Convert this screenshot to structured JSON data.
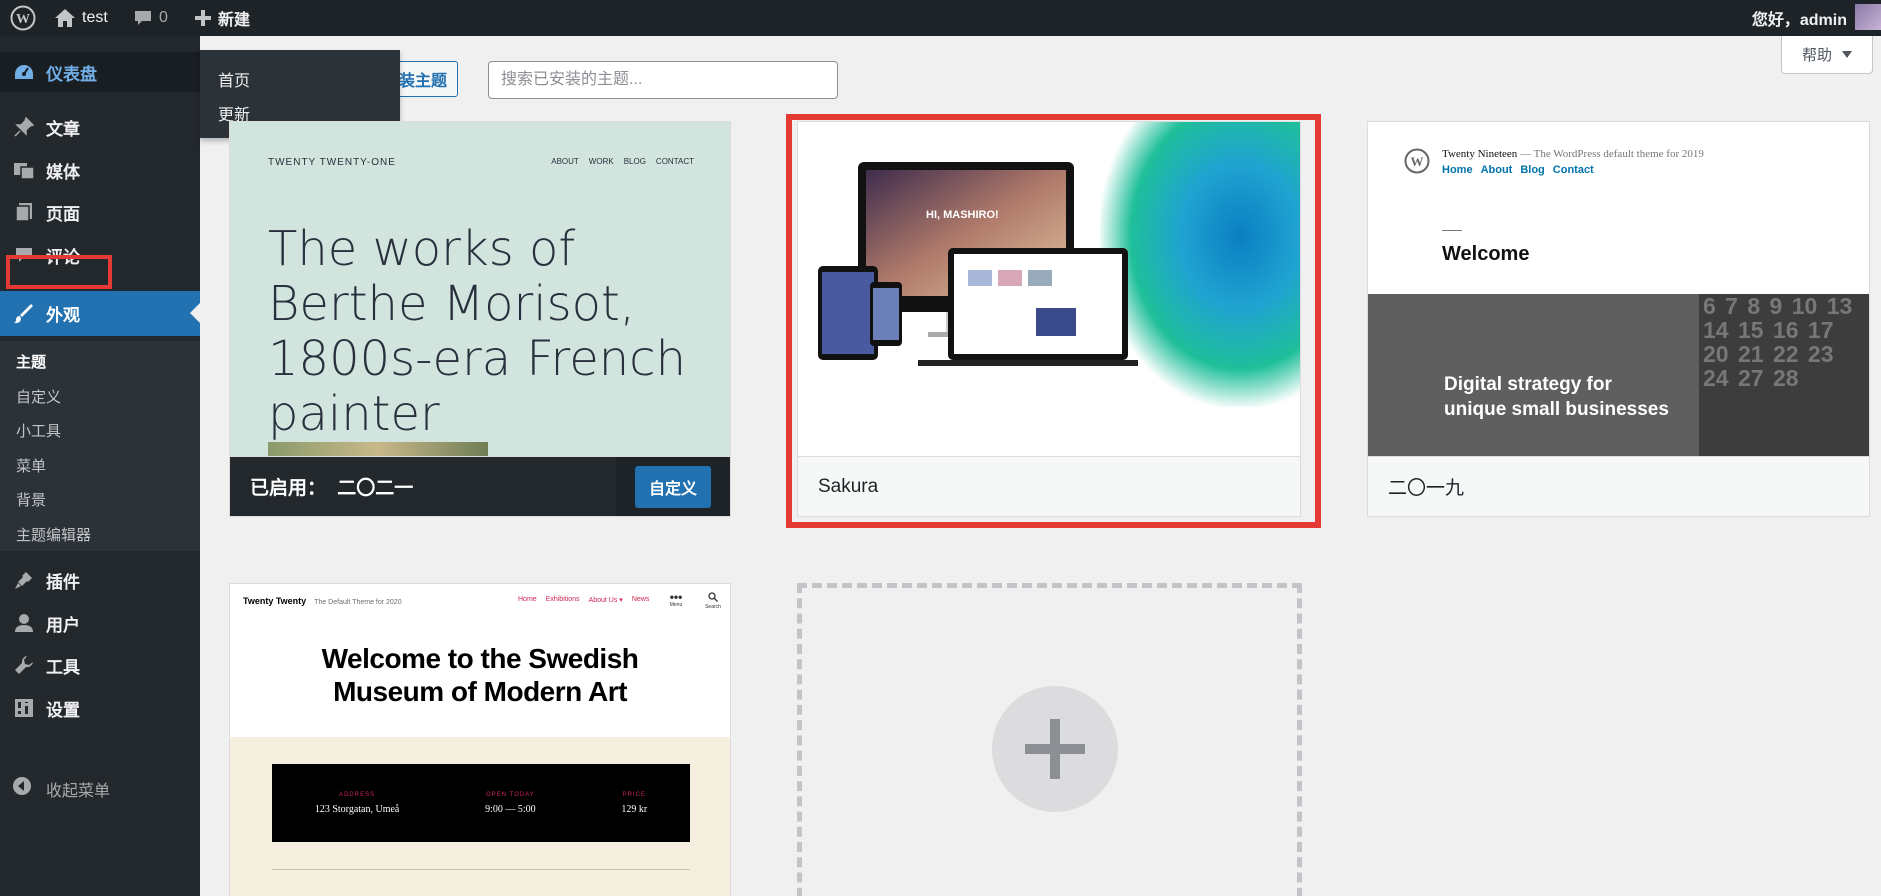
{
  "adminbar": {
    "site_name": "test",
    "comments_count": "0",
    "new_label": "新建",
    "greeting": "您好，admin"
  },
  "sidebar": {
    "dashboard": "仪表盘",
    "items": [
      {
        "label": "文章",
        "icon": "pushpin-icon"
      },
      {
        "label": "媒体",
        "icon": "media-icon"
      },
      {
        "label": "页面",
        "icon": "page-icon"
      },
      {
        "label": "评论",
        "icon": "comment-icon"
      }
    ],
    "appearance": "外观",
    "submenu": [
      "主题",
      "自定义",
      "小工具",
      "菜单",
      "背景",
      "主题编辑器"
    ],
    "items_after": [
      {
        "label": "插件",
        "icon": "plugin-icon"
      },
      {
        "label": "用户",
        "icon": "user-icon"
      },
      {
        "label": "工具",
        "icon": "wrench-icon"
      },
      {
        "label": "设置",
        "icon": "settings-icon"
      }
    ],
    "collapse": "收起菜单"
  },
  "flyout": {
    "items": [
      "首页",
      "更新"
    ]
  },
  "toolbar": {
    "add_theme": "装主题",
    "search_placeholder": "搜索已安装的主题...",
    "help": "帮助"
  },
  "themes": {
    "active": {
      "prefix": "已启用：",
      "name": "二〇二一",
      "customize": "自定义",
      "screenshot": {
        "brand": "TWENTY TWENTY-ONE",
        "nav": [
          "ABOUT",
          "WORK",
          "BLOG",
          "CONTACT"
        ],
        "headline": "The works of Berthe Morisot, 1800s-era French painter"
      }
    },
    "sakura": {
      "name": "Sakura",
      "screenshot_text": "HI, MASHIRO!"
    },
    "nineteen": {
      "name": "二〇一九",
      "site_title": "Twenty Nineteen",
      "tagline": "— The WordPress default theme for 2019",
      "nav": [
        "Home",
        "About",
        "Blog",
        "Contact"
      ],
      "welcome": "Welcome",
      "hero_line1": "Digital strategy for",
      "hero_line2": "unique small businesses",
      "calendar_numbers": "6 7 8 9 10 13 14 15 16 17 20 21 22 23 24 27 28"
    },
    "twenty": {
      "site_title": "Twenty Twenty",
      "tagline": "The Default Theme for 2020",
      "nav": [
        "Home",
        "Exhibitions",
        "About Us ▾",
        "News"
      ],
      "menu_label": "Menu",
      "search_label": "Search",
      "headline_line1": "Welcome to the Swedish",
      "headline_line2": "Museum of Modern Art",
      "info": [
        {
          "label": "ADDRESS",
          "value": "123 Storgatan, Umeå"
        },
        {
          "label": "OPEN TODAY",
          "value": "9:00 — 5:00"
        },
        {
          "label": "PRICE",
          "value": "129 kr"
        }
      ]
    }
  },
  "colors": {
    "admin_dark": "#1d2327",
    "sidebar": "#23282d",
    "accent_blue": "#2271b1",
    "highlight_red": "#e53935",
    "t21_bg": "#d1e4dd",
    "t20_accent": "#cd2653"
  }
}
